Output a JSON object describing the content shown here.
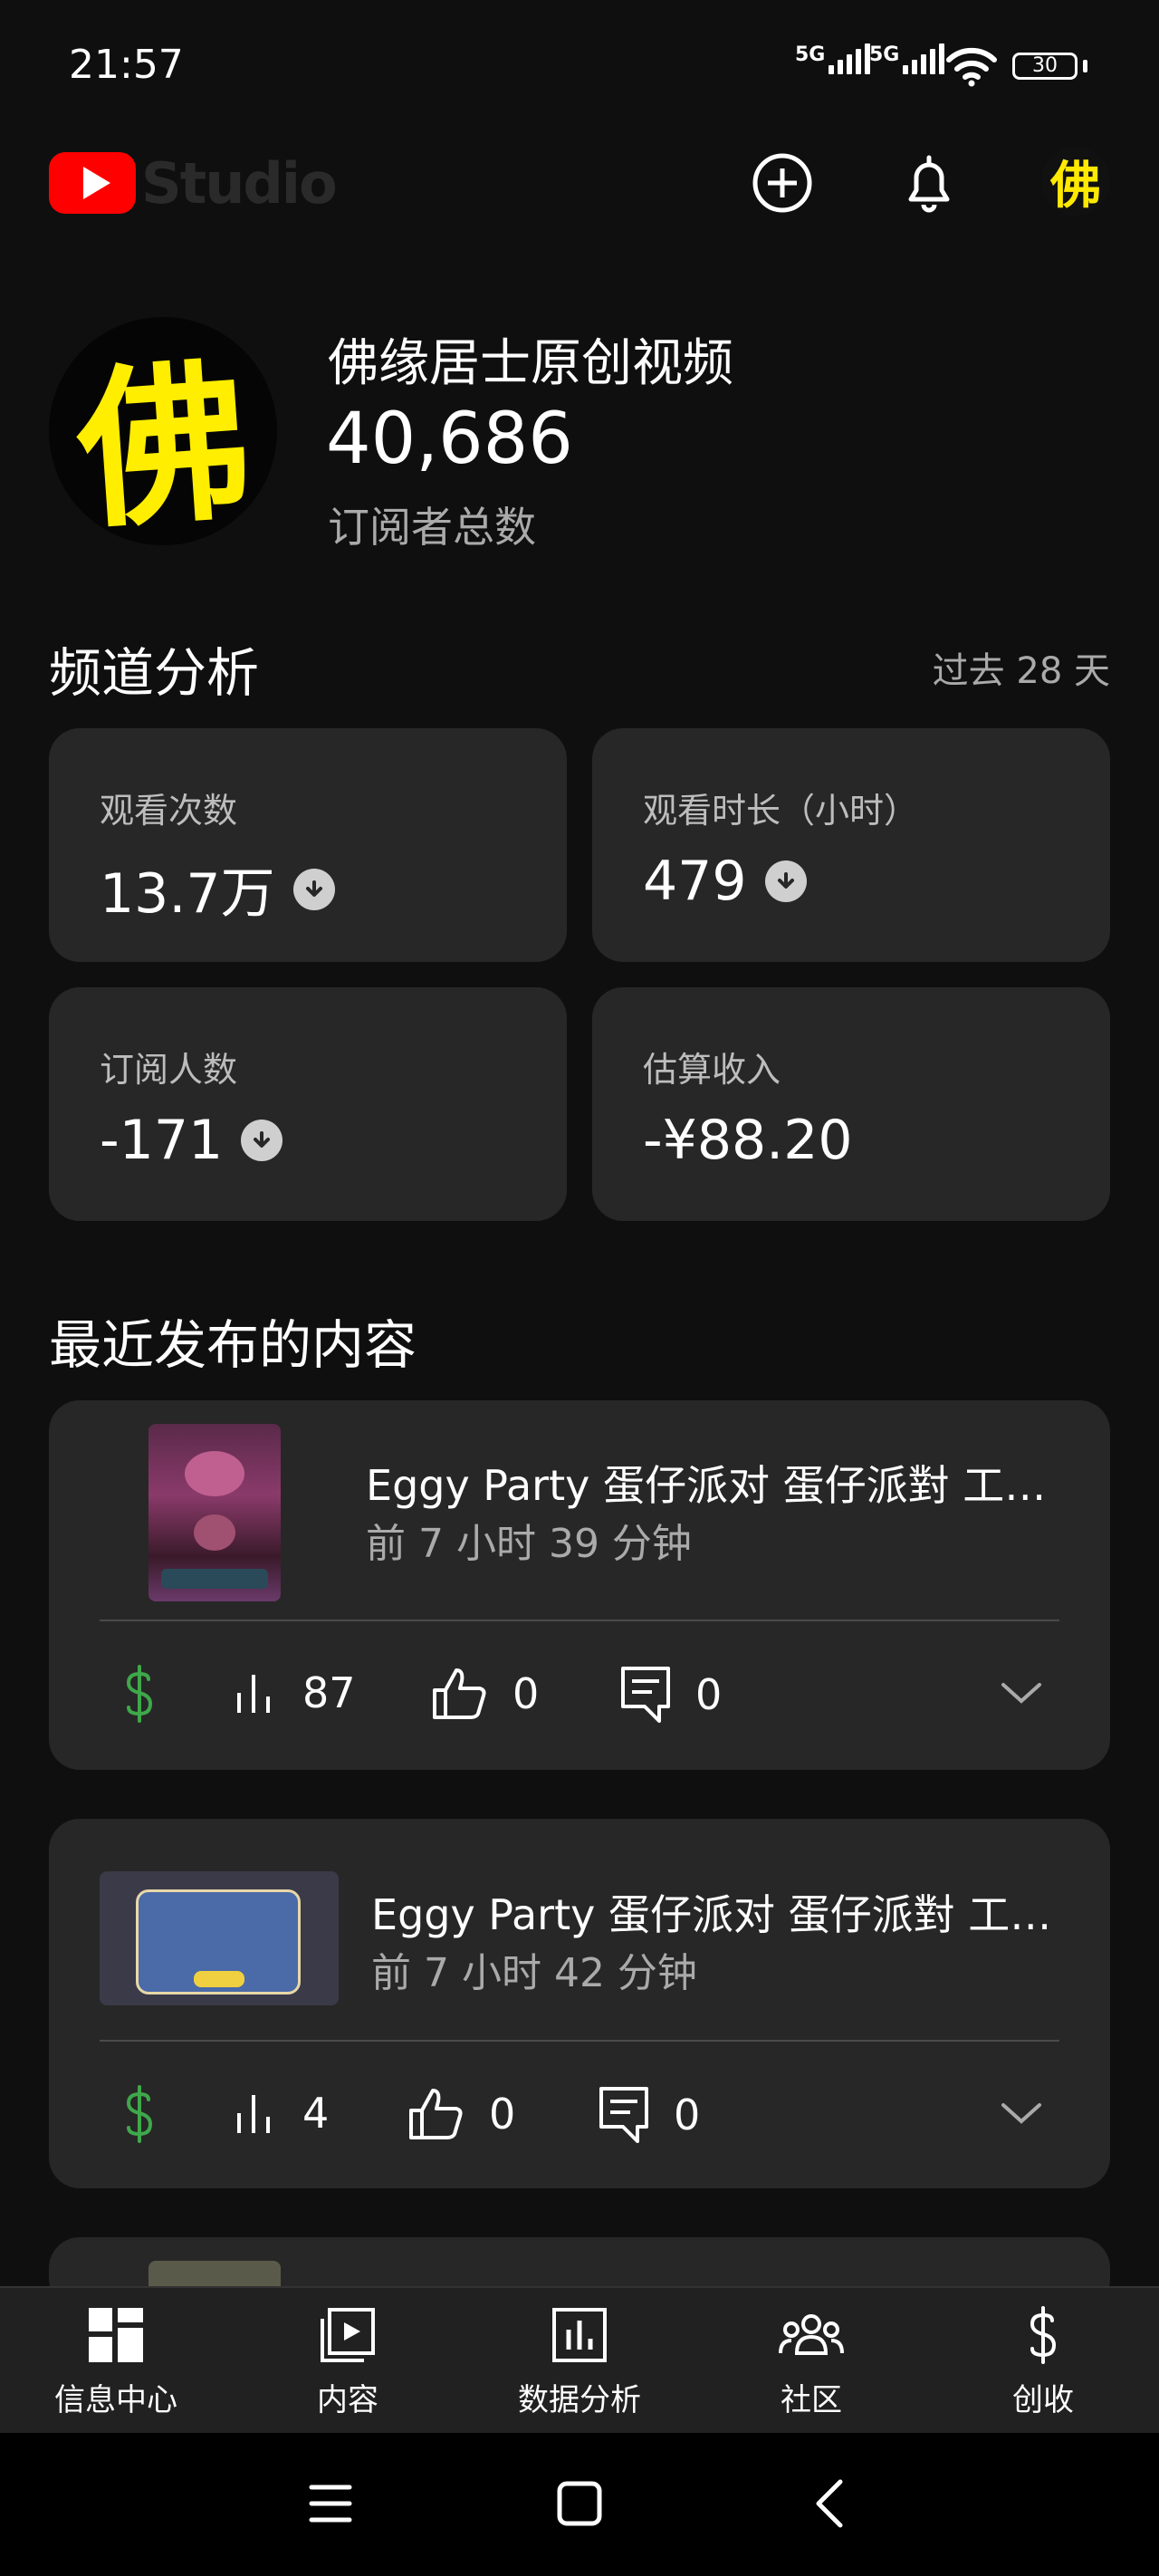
{
  "status_bar": {
    "time": "21:57",
    "net1": "5G",
    "net2": "5G",
    "battery": "30"
  },
  "app_bar": {
    "logo_word": "Studio"
  },
  "channel": {
    "name": "佛缘居士原创视频",
    "subscribers": "40,686",
    "subscribers_label": "订阅者总数",
    "avatar_char": "佛"
  },
  "analytics": {
    "title": "频道分析",
    "period": "过去 28 天",
    "cards": [
      {
        "label": "观看次数",
        "value": "13.7万",
        "trend": "down"
      },
      {
        "label": "观看时长（小时）",
        "value": "479",
        "trend": "down"
      },
      {
        "label": "订阅人数",
        "value": "-171",
        "trend": "down"
      },
      {
        "label": "估算收入",
        "value": "-¥88.20"
      }
    ]
  },
  "recent": {
    "title": "最近发布的内容",
    "videos": [
      {
        "title": "Eggy Party 蛋仔派对 蛋仔派對 工具人 ...",
        "time": "前 7 小时 39 分钟",
        "views": "87",
        "likes": "0",
        "comments": "0"
      },
      {
        "title": "Eggy Party 蛋仔派对 蛋仔派對 工具人 ...",
        "time": "前 7 小时 42 分钟",
        "views": "4",
        "likes": "0",
        "comments": "0"
      }
    ]
  },
  "bottom_nav": [
    {
      "label": "信息中心",
      "icon": "dashboard-icon"
    },
    {
      "label": "内容",
      "icon": "content-icon"
    },
    {
      "label": "数据分析",
      "icon": "analytics-icon"
    },
    {
      "label": "社区",
      "icon": "community-icon"
    },
    {
      "label": "创收",
      "icon": "earn-icon"
    }
  ],
  "colors": {
    "background": "#0f0f0f",
    "card": "#272727",
    "accent_green": "#3ea84a",
    "brand_red": "#ff0000",
    "avatar_yellow": "#ffee00"
  }
}
